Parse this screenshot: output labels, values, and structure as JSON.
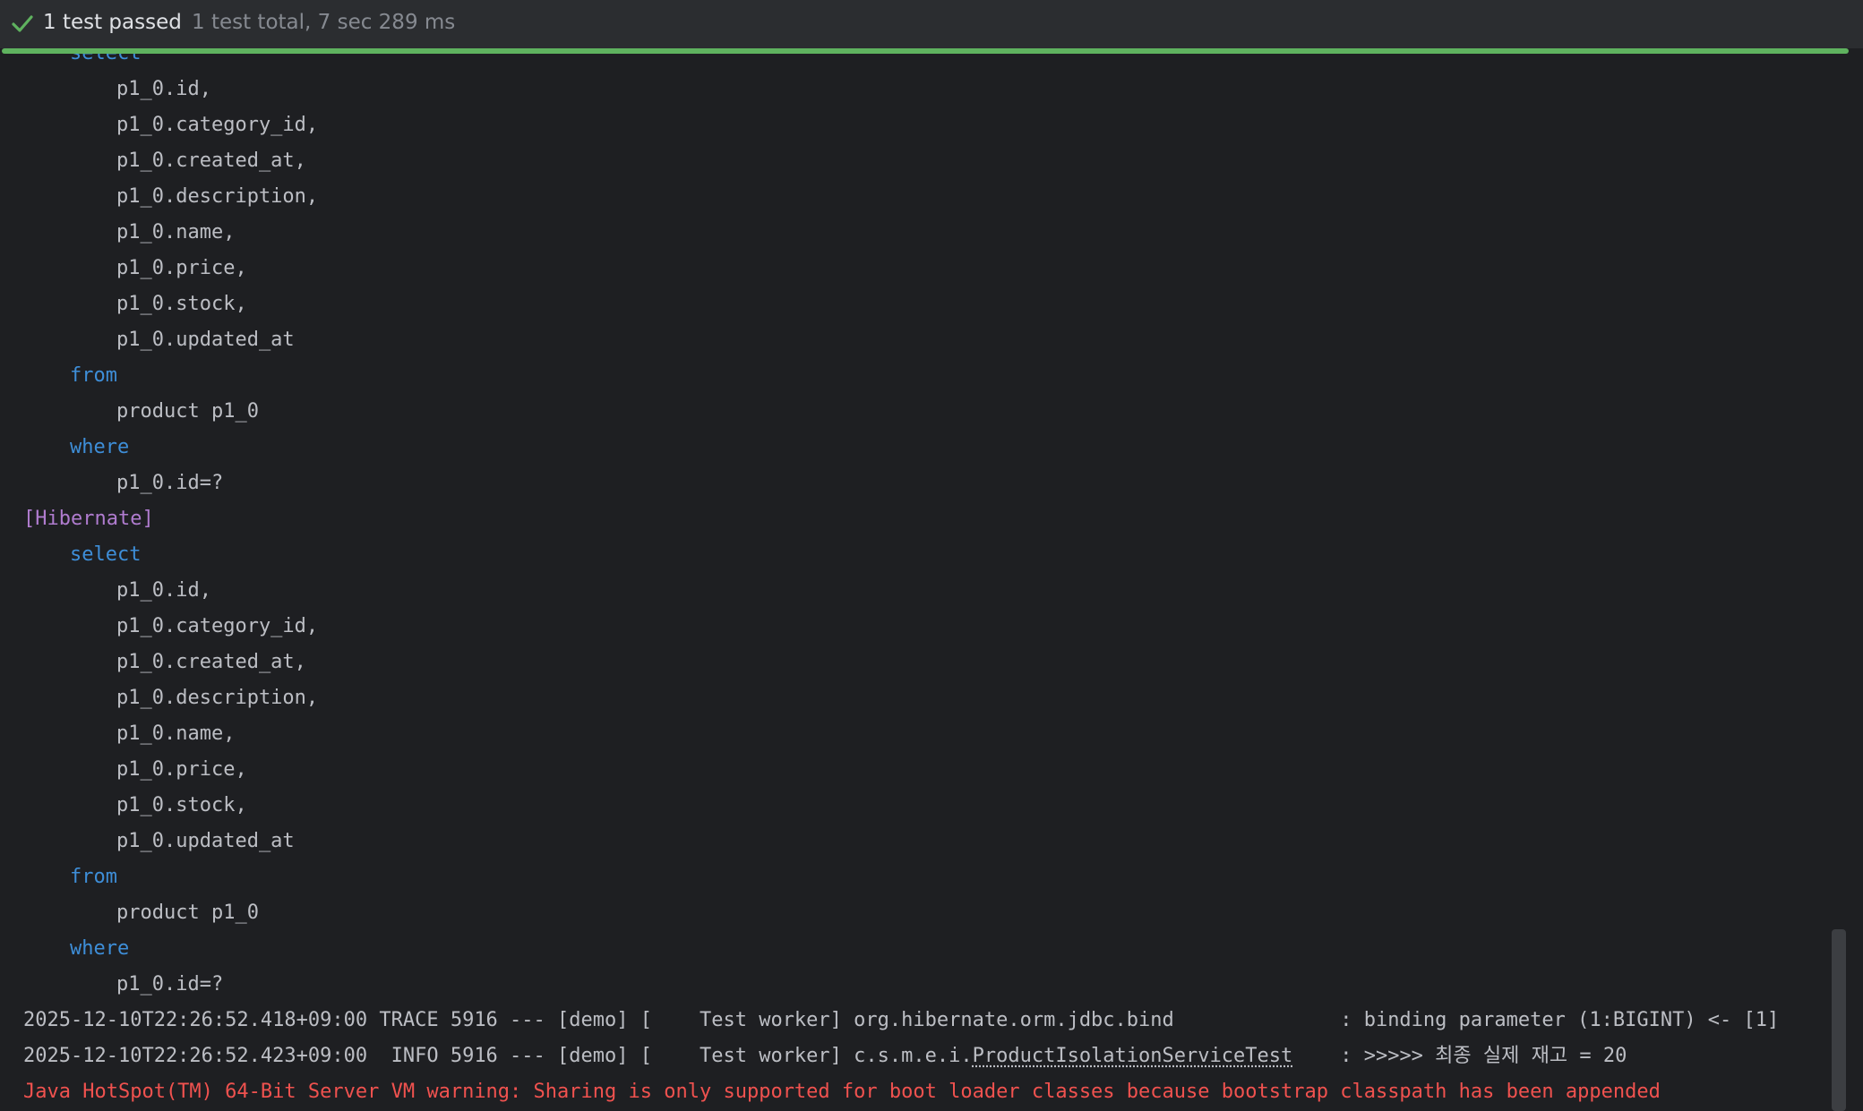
{
  "status": {
    "icon": "check-icon",
    "passed_label": "1 test passed",
    "detail_label": "1 test total, 7 sec 289 ms",
    "accent_color": "#5fb25f",
    "progress": 1.0
  },
  "console": {
    "lines": [
      {
        "indent": 1,
        "style": "kw",
        "text": "select"
      },
      {
        "indent": 2,
        "style": "plain",
        "text": "p1_0.id,"
      },
      {
        "indent": 2,
        "style": "plain",
        "text": "p1_0.category_id,"
      },
      {
        "indent": 2,
        "style": "plain",
        "text": "p1_0.created_at,"
      },
      {
        "indent": 2,
        "style": "plain",
        "text": "p1_0.description,"
      },
      {
        "indent": 2,
        "style": "plain",
        "text": "p1_0.name,"
      },
      {
        "indent": 2,
        "style": "plain",
        "text": "p1_0.price,"
      },
      {
        "indent": 2,
        "style": "plain",
        "text": "p1_0.stock,"
      },
      {
        "indent": 2,
        "style": "plain",
        "text": "p1_0.updated_at"
      },
      {
        "indent": 1,
        "style": "kw",
        "text": "from"
      },
      {
        "indent": 2,
        "style": "plain",
        "text": "product p1_0"
      },
      {
        "indent": 1,
        "style": "kw",
        "text": "where"
      },
      {
        "indent": 2,
        "style": "plain",
        "text": "p1_0.id=?"
      },
      {
        "indent": 0,
        "style": "hib",
        "text": "[Hibernate]"
      },
      {
        "indent": 1,
        "style": "kw",
        "text": "select"
      },
      {
        "indent": 2,
        "style": "plain",
        "text": "p1_0.id,"
      },
      {
        "indent": 2,
        "style": "plain",
        "text": "p1_0.category_id,"
      },
      {
        "indent": 2,
        "style": "plain",
        "text": "p1_0.created_at,"
      },
      {
        "indent": 2,
        "style": "plain",
        "text": "p1_0.description,"
      },
      {
        "indent": 2,
        "style": "plain",
        "text": "p1_0.name,"
      },
      {
        "indent": 2,
        "style": "plain",
        "text": "p1_0.price,"
      },
      {
        "indent": 2,
        "style": "plain",
        "text": "p1_0.stock,"
      },
      {
        "indent": 2,
        "style": "plain",
        "text": "p1_0.updated_at"
      },
      {
        "indent": 1,
        "style": "kw",
        "text": "from"
      },
      {
        "indent": 2,
        "style": "plain",
        "text": "product p1_0"
      },
      {
        "indent": 1,
        "style": "kw",
        "text": "where"
      },
      {
        "indent": 2,
        "style": "plain",
        "text": "p1_0.id=?"
      }
    ],
    "log1": {
      "text": "2025-12-10T22:26:52.418+09:00 TRACE 5916 --- [demo] [    Test worker] org.hibernate.orm.jdbc.bind              : binding parameter (1:BIGINT) <- [1]"
    },
    "log2": {
      "prefix": "2025-12-10T22:26:52.423+09:00  INFO 5916 --- [demo] [    Test worker] c.s.m.e.i.",
      "class_name": "ProductIsolationServiceTest",
      "suffix": "    : >>>>> 최종 실제 재고 = 20"
    },
    "warning": "Java HotSpot(TM) 64-Bit Server VM warning: Sharing is only supported for boot loader classes because bootstrap classpath has been appended"
  }
}
